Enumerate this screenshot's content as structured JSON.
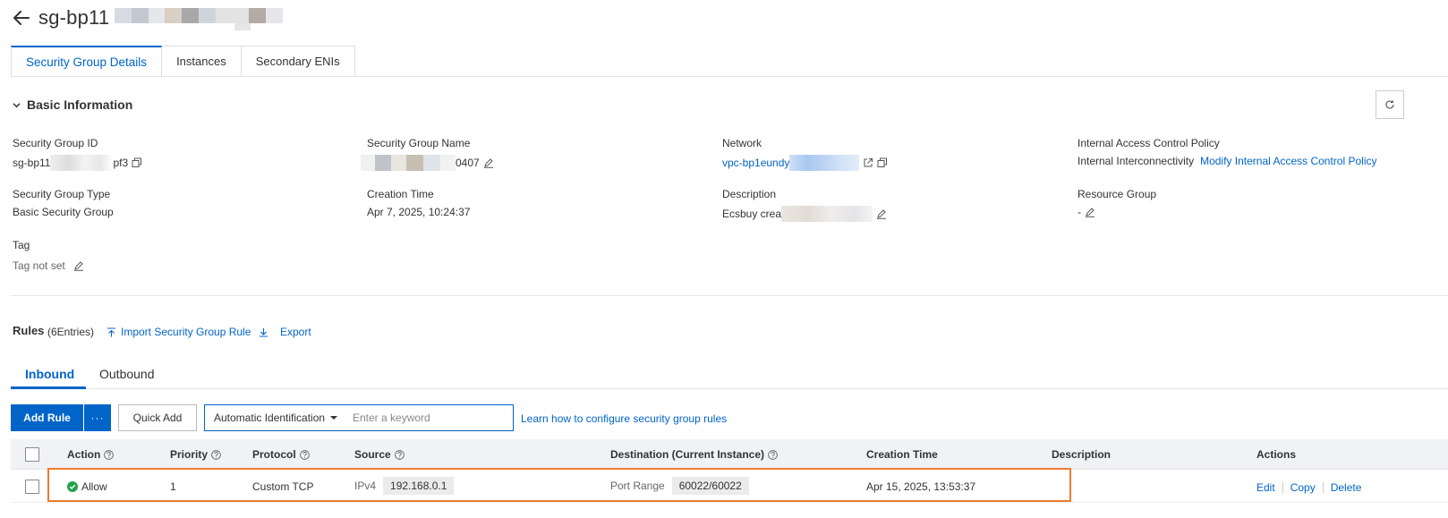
{
  "header": {
    "title": "sg-bp11",
    "title_blur_colors": [
      "#d6dbe3",
      "#c3c8d0",
      "#d9cfc4",
      "#a8a8a8",
      "#cfd4dc",
      "#e3e3e3",
      "#b3aba4",
      "#e4e6ea"
    ]
  },
  "tabs": [
    {
      "label": "Security Group Details",
      "active": true
    },
    {
      "label": "Instances",
      "active": false
    },
    {
      "label": "Secondary ENIs",
      "active": false
    }
  ],
  "basic_info": {
    "title": "Basic Information",
    "fields": {
      "sg_id": {
        "label": "Security Group ID",
        "value_prefix": "sg-bp11",
        "value_suffix": "pf3"
      },
      "sg_name": {
        "label": "Security Group Name",
        "value_suffix": "0407"
      },
      "network": {
        "label": "Network",
        "value": "vpc-bp1eundy"
      },
      "policy": {
        "label": "Internal Access Control Policy",
        "value": "Internal Interconnectivity",
        "link": "Modify Internal Access Control Policy"
      },
      "sg_type": {
        "label": "Security Group Type",
        "value": "Basic Security Group"
      },
      "created": {
        "label": "Creation Time",
        "value": "Apr 7, 2025, 10:24:37"
      },
      "description": {
        "label": "Description",
        "value": "Ecsbuy crea"
      },
      "resource_group": {
        "label": "Resource Group",
        "value": "-"
      },
      "tag": {
        "label": "Tag",
        "value": "Tag not set"
      }
    }
  },
  "rules": {
    "title": "Rules",
    "count": "(6Entries)",
    "import_label": "Import Security Group Rule",
    "export_label": "Export",
    "subtabs": {
      "inbound": "Inbound",
      "outbound": "Outbound"
    },
    "toolbar": {
      "add_rule": "Add Rule",
      "more": "···",
      "quick_add": "Quick Add",
      "select_value": "Automatic Identification",
      "search_placeholder": "Enter a keyword",
      "learn_link": "Learn how to configure security group rules"
    },
    "columns": {
      "action": "Action",
      "priority": "Priority",
      "protocol": "Protocol",
      "source": "Source",
      "destination": "Destination (Current Instance)",
      "created": "Creation Time",
      "description": "Description",
      "actions": "Actions"
    },
    "rows": [
      {
        "action": "Allow",
        "priority": "1",
        "protocol": "Custom TCP",
        "source_type": "IPv4",
        "source_value": "192.168.0.1",
        "dest_label": "Port Range",
        "dest_value": "60022/60022",
        "created": "Apr 15, 2025, 13:53:37",
        "description": "",
        "edit": "Edit",
        "copy": "Copy",
        "delete": "Delete"
      }
    ]
  },
  "colors": {
    "accent": "#0064c8",
    "highlight": "#ee7b30",
    "success": "#22a34a"
  }
}
